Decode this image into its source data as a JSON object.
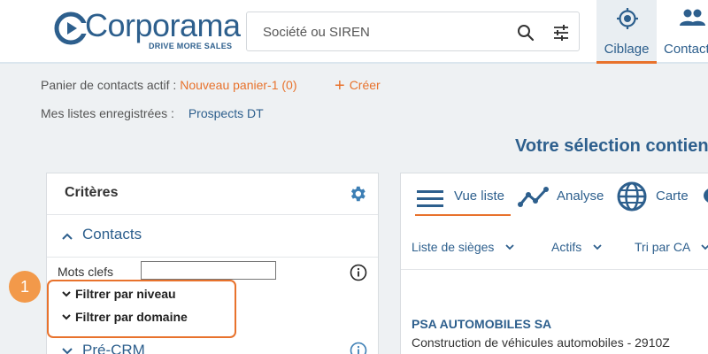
{
  "header": {
    "logo_text": "Corporama",
    "logo_tagline": "DRIVE MORE SALES",
    "search_placeholder": "Société ou SIREN",
    "nav": [
      {
        "label": "Ciblage",
        "active": true
      },
      {
        "label": "Contacts",
        "active": false
      }
    ]
  },
  "cart": {
    "label": "Panier de contacts actif :",
    "value": "Nouveau panier-1 (0)",
    "create_label": "Créer"
  },
  "lists": {
    "label": "Mes listes enregistrées :",
    "value": "Prospects DT"
  },
  "selection_text": "Votre sélection contient",
  "criteria": {
    "title": "Critères",
    "section": "Contacts",
    "keywords_label": "Mots clefs",
    "keywords_value": "",
    "filters": [
      "Filtrer par niveau",
      "Filtrer par domaine"
    ],
    "next_section": "Pré-CRM"
  },
  "step_badge": "1",
  "results": {
    "views": [
      "Vue liste",
      "Analyse",
      "Carte"
    ],
    "dropdowns": [
      "Liste de sièges",
      "Actifs",
      "Tri par CA"
    ],
    "company_name": "PSA AUTOMOBILES SA",
    "company_desc": "Construction de véhicules automobiles - 2910Z"
  },
  "colors": {
    "brand_blue": "#2d5f8d",
    "accent_orange": "#e8722c",
    "badge_orange": "#f2994a"
  }
}
